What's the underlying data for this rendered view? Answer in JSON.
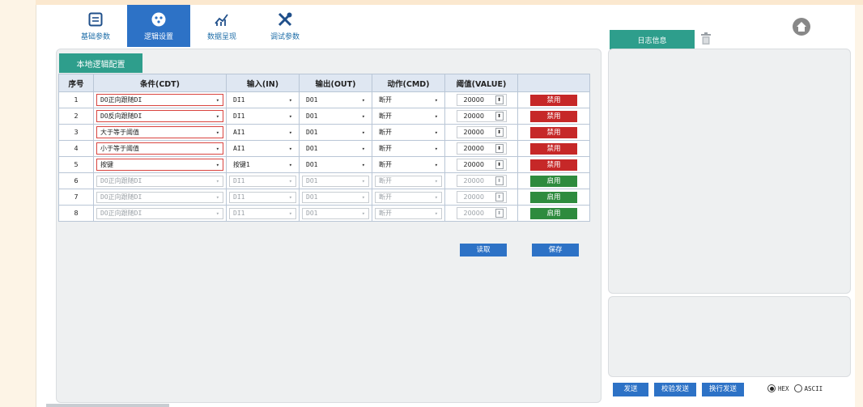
{
  "nav": [
    {
      "label": "基础参数",
      "icon": "monitor-icon",
      "active": false
    },
    {
      "label": "逻辑设置",
      "icon": "brain-icon",
      "active": true
    },
    {
      "label": "数据呈现",
      "icon": "chart-icon",
      "active": false
    },
    {
      "label": "调试参数",
      "icon": "tools-icon",
      "active": false
    }
  ],
  "sub_tab": "本地逻辑配置",
  "table": {
    "headers": [
      "序号",
      "条件(CDT)",
      "输入(IN)",
      "输出(OUT)",
      "动作(CMD)",
      "阈值(VALUE)",
      ""
    ],
    "rows": [
      {
        "no": "1",
        "cond": "DO正向跟随DI",
        "in": "DI1",
        "out": "DO1",
        "cmd": "断开",
        "value": "20000",
        "action": "禁用",
        "enabled": true
      },
      {
        "no": "2",
        "cond": "DO反向跟随DI",
        "in": "DI1",
        "out": "DO1",
        "cmd": "断开",
        "value": "20000",
        "action": "禁用",
        "enabled": true
      },
      {
        "no": "3",
        "cond": "大于等于阈值",
        "in": "AI1",
        "out": "DO1",
        "cmd": "断开",
        "value": "20000",
        "action": "禁用",
        "enabled": true
      },
      {
        "no": "4",
        "cond": "小于等于阈值",
        "in": "AI1",
        "out": "DO1",
        "cmd": "断开",
        "value": "20000",
        "action": "禁用",
        "enabled": true
      },
      {
        "no": "5",
        "cond": "按键",
        "in": "按键1",
        "out": "DO1",
        "cmd": "断开",
        "value": "20000",
        "action": "禁用",
        "enabled": true
      },
      {
        "no": "6",
        "cond": "DO正向跟随DI",
        "in": "DI1",
        "out": "DO1",
        "cmd": "断开",
        "value": "20000",
        "action": "启用",
        "enabled": false
      },
      {
        "no": "7",
        "cond": "DO正向跟随DI",
        "in": "DI1",
        "out": "DO1",
        "cmd": "断开",
        "value": "20000",
        "action": "启用",
        "enabled": false
      },
      {
        "no": "8",
        "cond": "DO正向跟随DI",
        "in": "DI1",
        "out": "DO1",
        "cmd": "断开",
        "value": "20000",
        "action": "启用",
        "enabled": false
      }
    ]
  },
  "footer": {
    "read": "读取",
    "save": "保存"
  },
  "log": {
    "title": "日志信息",
    "send": "发送",
    "verify_send": "校验发送",
    "newline_send": "换行发送",
    "hex": "HEX",
    "ascii": "ASCII"
  },
  "colors": {
    "accent_blue": "#2d72c6",
    "teal": "#2e9e8c",
    "disable_red": "#c62828",
    "enable_green": "#2e8b3e",
    "cond_border": "#d9443f"
  }
}
